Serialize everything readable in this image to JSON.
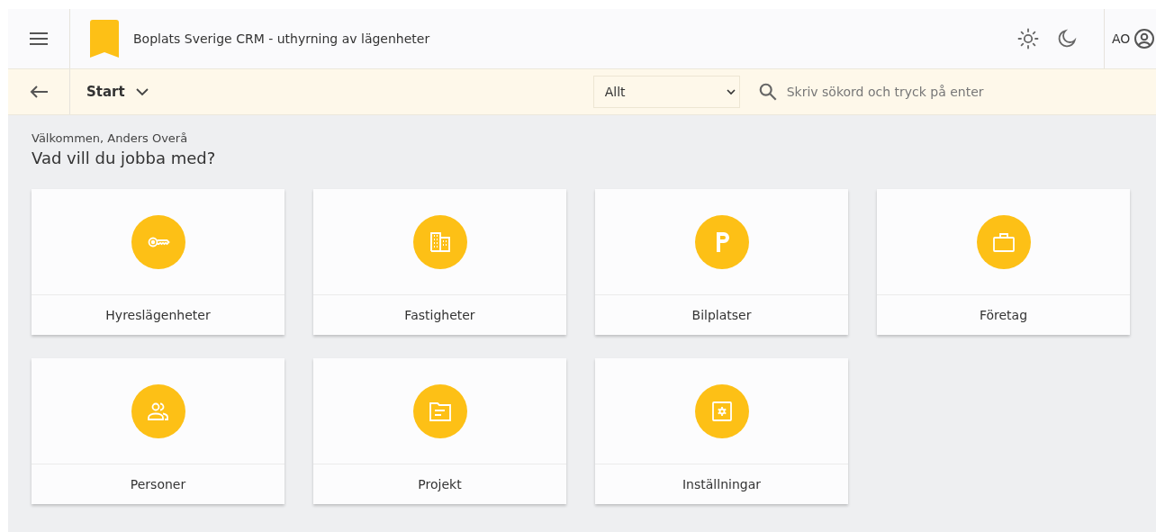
{
  "header": {
    "title": "Boplats Sverige CRM - uthyrning av lägenheter",
    "user_initials": "AO"
  },
  "toolbar": {
    "breadcrumb": "Start",
    "filter": "Allt",
    "search": {
      "placeholder": "Skriv sökord och tryck på enter"
    }
  },
  "welcome": "Välkommen, Anders Overå",
  "heading": "Vad vill du jobba med?",
  "tiles": [
    {
      "label": "Hyreslägenheter"
    },
    {
      "label": "Fastigheter"
    },
    {
      "label": "Bilplatser"
    },
    {
      "label": "Företag"
    },
    {
      "label": "Personer"
    },
    {
      "label": "Projekt"
    },
    {
      "label": "Inställningar"
    }
  ]
}
